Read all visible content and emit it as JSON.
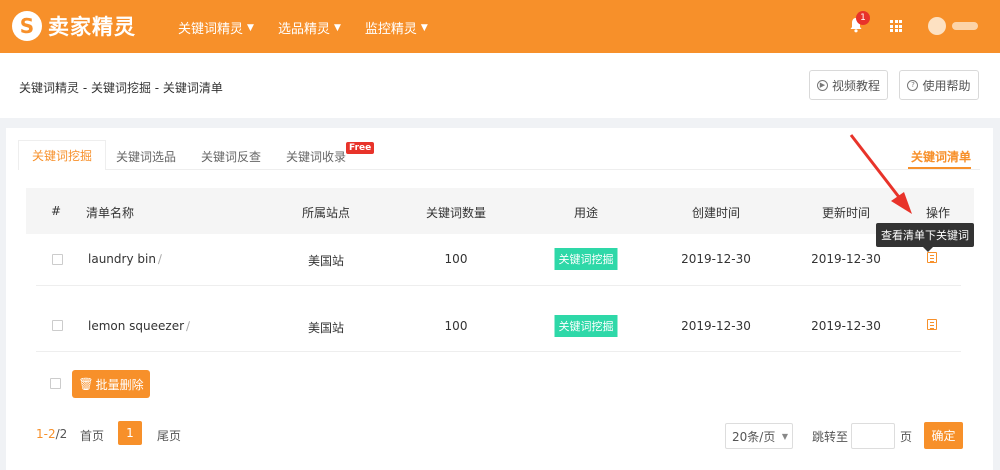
{
  "brand": {
    "logo_letter": "S",
    "name": "卖家精灵"
  },
  "topnav": [
    {
      "label": "关键词精灵"
    },
    {
      "label": "选品精灵"
    },
    {
      "label": "监控精灵"
    }
  ],
  "notifications": {
    "count": "1"
  },
  "breadcrumb": "关键词精灵 - 关键词挖掘 - 关键词清单",
  "header_buttons": {
    "video": "视频教程",
    "help": "使用帮助"
  },
  "tabs": {
    "mining": "关键词挖掘",
    "product": "关键词选品",
    "reverse": "关键词反查",
    "collect": "关键词收录",
    "free_badge": "Free",
    "list": "关键词清单"
  },
  "table": {
    "headers": [
      "#",
      "清单名称",
      "所属站点",
      "关键词数量",
      "用途",
      "创建时间",
      "更新时间",
      "操作"
    ],
    "rows": [
      {
        "name": "laundry bin",
        "site": "美国站",
        "count": "100",
        "usage": "关键词挖掘",
        "created": "2019-12-30",
        "updated": "2019-12-30"
      },
      {
        "name": "lemon squeezer",
        "site": "美国站",
        "count": "100",
        "usage": "关键词挖掘",
        "created": "2019-12-30",
        "updated": "2019-12-30"
      }
    ]
  },
  "tooltip": "查看清单下关键词",
  "bulk_delete": "批量删除",
  "pagination": {
    "range": "1-2",
    "total": "2",
    "first": "首页",
    "current": "1",
    "last": "尾页",
    "page_size": "20条/页",
    "jump_to": "跳转至",
    "page_unit": "页",
    "confirm": "确定"
  },
  "colors": {
    "brand": "#f7902a",
    "usage_tag": "#2ed8a8",
    "badge": "#e8332a"
  }
}
